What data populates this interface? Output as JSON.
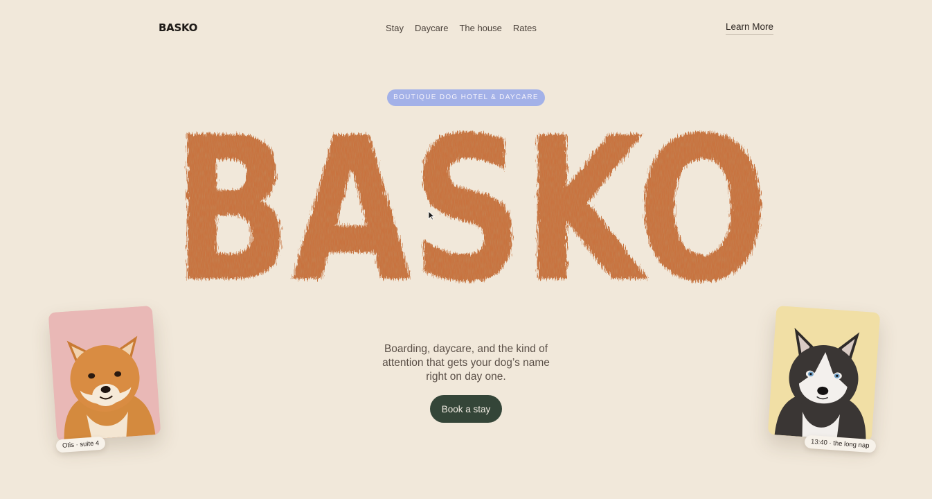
{
  "brand": {
    "name": "BASKO"
  },
  "nav": {
    "items": [
      {
        "label": "Stay"
      },
      {
        "label": "Daycare"
      },
      {
        "label": "The house"
      },
      {
        "label": "Rates"
      }
    ],
    "cta_label": "Learn More"
  },
  "hero": {
    "badge": "BOUTIQUE DOG HOTEL & DAYCARE",
    "title": "BASKO",
    "tagline": "Boarding, daycare, and the kind of attention that gets your dog’s name right on day one.",
    "button_label": "Book a stay"
  },
  "cards": {
    "left": {
      "caption": "Otis · suite 4"
    },
    "right": {
      "caption": "13:40 · the long nap"
    }
  },
  "colors": {
    "background": "#f1e8da",
    "fur": "#c8733f",
    "badge": "#a3b1e8",
    "button": "#344538",
    "card_left": "#e9b8b6",
    "card_right": "#f1dfa5"
  }
}
